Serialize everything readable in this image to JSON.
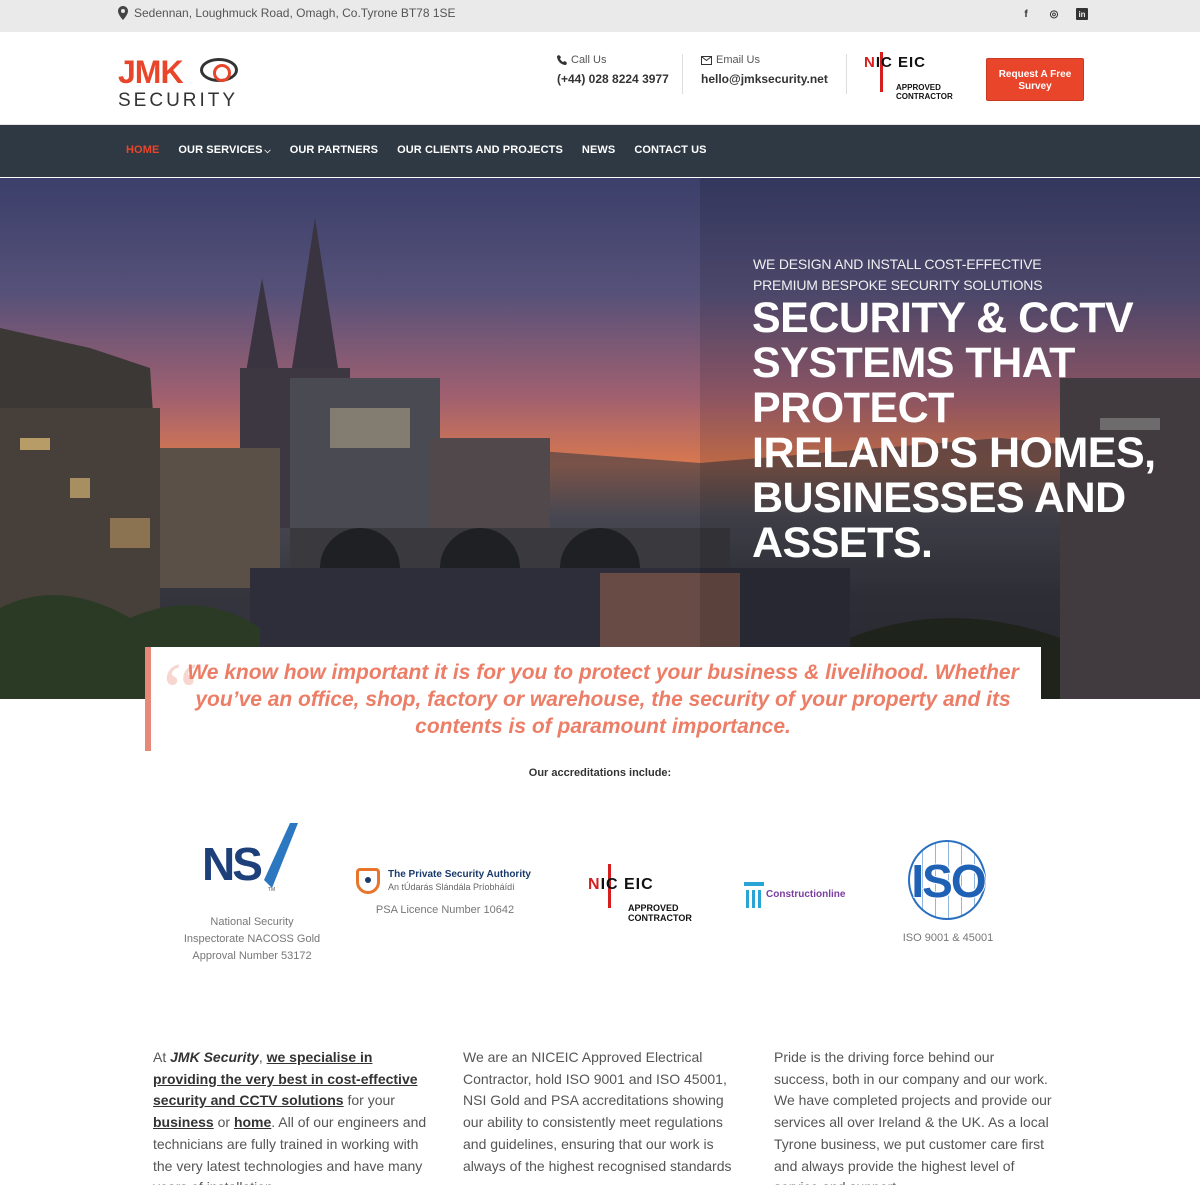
{
  "topbar": {
    "address": "Sedennan, Loughmuck Road, Omagh, Co.Tyrone BT78 1SE",
    "social": [
      "f",
      "◎",
      "in"
    ]
  },
  "header": {
    "logo_line1": "JMK",
    "logo_line2": "SECURITY",
    "call_label": "Call Us",
    "call_value": "(+44) 028 8224 3977",
    "email_label": "Email Us",
    "email_value": "hello@jmksecurity.net",
    "niceic_text": "APPROVED CONTRACTOR",
    "cta_label": "Request A Free Survey"
  },
  "nav": {
    "items": [
      "HOME",
      "OUR SERVICES",
      "OUR PARTNERS",
      "OUR CLIENTS AND PROJECTS",
      "NEWS",
      "CONTACT US"
    ]
  },
  "hero": {
    "kicker_line1": "WE DESIGN AND INSTALL COST-EFFECTIVE",
    "kicker_line2": "PREMIUM BESPOKE SECURITY SOLUTIONS",
    "headline": "SECURITY & CCTV SYSTEMS THAT PROTECT IRELAND'S HOMES, BUSINESSES AND ASSETS."
  },
  "quote": {
    "text": "We know how important it is for you to protect your business & livelihood.  Whether you’ve an office, shop, factory or warehouse, the security of your property and its contents is of paramount importance."
  },
  "accreditations": {
    "title": "Our accreditations include:",
    "nsi_caption": "National Security Inspectorate NACOSS Gold Approval Number 53172",
    "psa_name": "The Private Security Authority",
    "psa_irish": "An tÚdarás Slándála Príobháídí",
    "psa_caption": "PSA Licence Number 10642",
    "niceic_text": "APPROVED CONTRACTOR",
    "constructionline": "Constructionline",
    "iso_text": "ISO",
    "iso_caption": "ISO 9001 & 45001"
  },
  "columns": {
    "c1_pre": "At ",
    "c1_brand": "JMK Security",
    "c1_comma": ", ",
    "c1_link1": "we specialise in providing the very best in cost-effective security and CCTV solutions",
    "c1_mid": " for your ",
    "c1_link2": "business",
    "c1_or": " or ",
    "c1_link3": "home",
    "c1_rest": ". All of our engineers and technicians are fully trained in working with the very latest technologies and have many years of installation",
    "c2": "We are an NICEIC Approved Electrical Contractor, hold ISO 9001 and ISO 45001, NSI Gold and PSA accreditations showing our ability to consistently meet regulations and guidelines, ensuring that our work is always of the highest recognised standards",
    "c3": "Pride is the driving force behind our success, both in our company and our work. We have completed projects and provide our services all over Ireland & the UK. As a local Tyrone business, we put customer care first and always provide the highest level of service and support"
  },
  "colors": {
    "accent": "#e8452b",
    "nav_bg": "#2f3943",
    "quote_text": "#ec7d66"
  }
}
